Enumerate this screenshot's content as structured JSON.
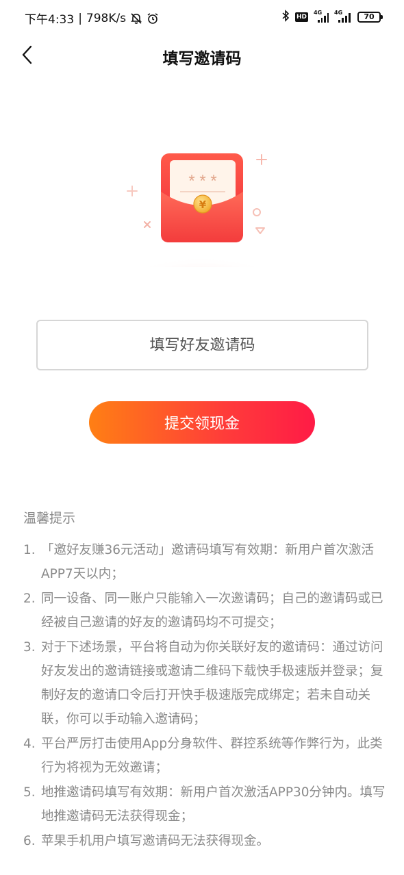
{
  "status_bar": {
    "time": "下午4:33",
    "separator": "|",
    "net_speed": "798K/s",
    "hd_label": "HD",
    "sig1_label": "4G",
    "sig2_label": "4G",
    "battery": "70"
  },
  "nav": {
    "title": "填写邀请码"
  },
  "illustration": {
    "card_text": "* * *",
    "coin_symbol": "¥"
  },
  "form": {
    "input_value": "",
    "input_placeholder": "填写好友邀请码",
    "submit_label": "提交领现金"
  },
  "tips": {
    "title": "温馨提示",
    "items": [
      {
        "num": "1.",
        "text": "「邀好友赚36元活动」邀请码填写有效期：新用户首次激活APP7天以内；"
      },
      {
        "num": "2.",
        "text": "同一设备、同一账户只能输入一次邀请码；自己的邀请码或已经被自己邀请的好友的邀请码均不可提交；"
      },
      {
        "num": "3.",
        "text": "对于下述场景，平台将自动为你关联好友的邀请码：通过访问好友发出的邀请链接或邀请二维码下载快手极速版并登录；复制好友的邀请口令后打开快手极速版完成绑定；若未自动关联，你可以手动输入邀请码；"
      },
      {
        "num": "4.",
        "text": "平台严厉打击使用App分身软件、群控系统等作弊行为，此类行为将视为无效邀请；"
      },
      {
        "num": "5.",
        "text": "地推邀请码填写有效期：新用户首次激活APP30分钟内。填写地推邀请码无法获得现金；"
      },
      {
        "num": "6.",
        "text": "苹果手机用户填写邀请码无法获得现金。"
      }
    ]
  },
  "colors": {
    "accent_start": "#ff7f14",
    "accent_end": "#ff1b46",
    "envelope_red": "#f23b3b",
    "tip_text": "#8a8a8a"
  }
}
